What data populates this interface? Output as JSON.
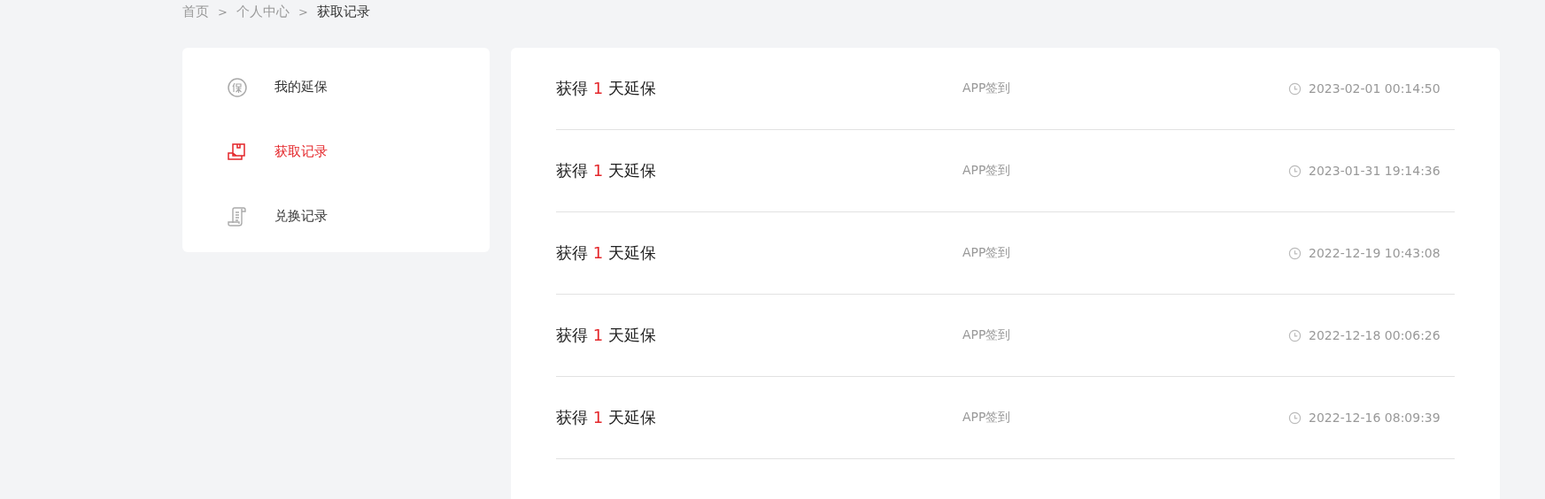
{
  "breadcrumb": [
    {
      "label": "首页",
      "current": false
    },
    {
      "label": "个人中心",
      "current": false
    },
    {
      "label": "获取记录",
      "current": true
    }
  ],
  "breadcrumb_separator": ">",
  "sidebar": {
    "items": [
      {
        "label": "我的延保",
        "kind": "badge",
        "selected": false
      },
      {
        "label": "获取记录",
        "kind": "box",
        "selected": true
      },
      {
        "label": "兑换记录",
        "kind": "scroll",
        "selected": false
      }
    ]
  },
  "records": [
    {
      "prefix": "获得",
      "count": "1",
      "suffix": "天延保",
      "source": "APP签到",
      "time": "2023-02-01 00:14:50"
    },
    {
      "prefix": "获得",
      "count": "1",
      "suffix": "天延保",
      "source": "APP签到",
      "time": "2023-01-31 19:14:36"
    },
    {
      "prefix": "获得",
      "count": "1",
      "suffix": "天延保",
      "source": "APP签到",
      "time": "2022-12-19 10:43:08"
    },
    {
      "prefix": "获得",
      "count": "1",
      "suffix": "天延保",
      "source": "APP签到",
      "time": "2022-12-18 00:06:26"
    },
    {
      "prefix": "获得",
      "count": "1",
      "suffix": "天延保",
      "source": "APP签到",
      "time": "2022-12-16 08:09:39"
    }
  ]
}
